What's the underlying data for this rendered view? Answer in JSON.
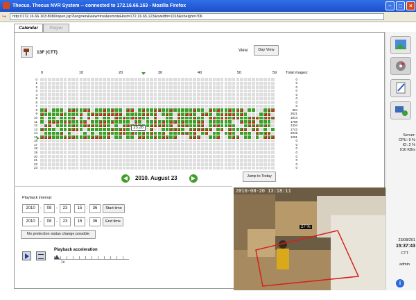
{
  "window": {
    "title": "Thecus. Thecus NVR System -- connected to 172.16.66.163 - Mozilla Firefox",
    "url": "http://172.16.66.163:8080/open.jsp?lang=en&view=inst&remoteHost=172.16.65.123&nwidth=1018&nheight=706"
  },
  "tabs": [
    {
      "label": "Calendar"
    },
    {
      "label": "Player"
    }
  ],
  "camera": {
    "name": "13F  (CTT)"
  },
  "view": {
    "label": "View:",
    "selected": "Day View"
  },
  "timeline": {
    "x_ticks": [
      "0",
      "10",
      "20",
      "30",
      "40",
      "50",
      "59"
    ],
    "hours": [
      "0",
      "1",
      "2",
      "3",
      "4",
      "5",
      "6",
      "7",
      "8",
      "9",
      "10",
      "11",
      "12",
      "13",
      "14",
      "15",
      "16",
      "17",
      "18",
      "19",
      "20",
      "21",
      "22",
      "23"
    ],
    "tooltip": "15:26",
    "total_images_label": "Total images:",
    "totals": [
      "0",
      "0",
      "0",
      "0",
      "0",
      "0",
      "0",
      "0",
      "304",
      "2621",
      "1813",
      "1786",
      "1334",
      "1742",
      "2015",
      "1201",
      "0",
      "0",
      "0",
      "0",
      "0",
      "0",
      "0",
      "0"
    ],
    "active_rows": [
      8,
      9,
      10,
      11,
      12,
      13,
      14,
      15
    ],
    "colors": {
      "green": "#3f9e2a",
      "red": "#c0281d",
      "empty": "#dddddd"
    }
  },
  "date_nav": {
    "date": "2010. August 23",
    "jump_label": "Jump to Today"
  },
  "playback": {
    "interval_label": "Playback interval:",
    "start": {
      "year": "2010",
      "month": "08",
      "day": "23",
      "hour": "15",
      "minute": "36",
      "button": "Start time"
    },
    "end": {
      "year": "2010",
      "month": "08",
      "day": "23",
      "hour": "15",
      "minute": "36",
      "button": "End time"
    },
    "protection_button": "No protection status change possible",
    "acceleration_label": "Playback acceleration",
    "acceleration_value": "1x"
  },
  "video": {
    "timestamp": "2010-08-20 13:18:11",
    "overlay": "27 %"
  },
  "sidebar": {
    "server_label": "Server:",
    "cpu": "CPU: 9 %",
    "io": "IO: 2 %",
    "net": "916 KB/s",
    "date": "23/08/201",
    "time": "15:37:43",
    "zone": "CTT",
    "user": "admin"
  }
}
